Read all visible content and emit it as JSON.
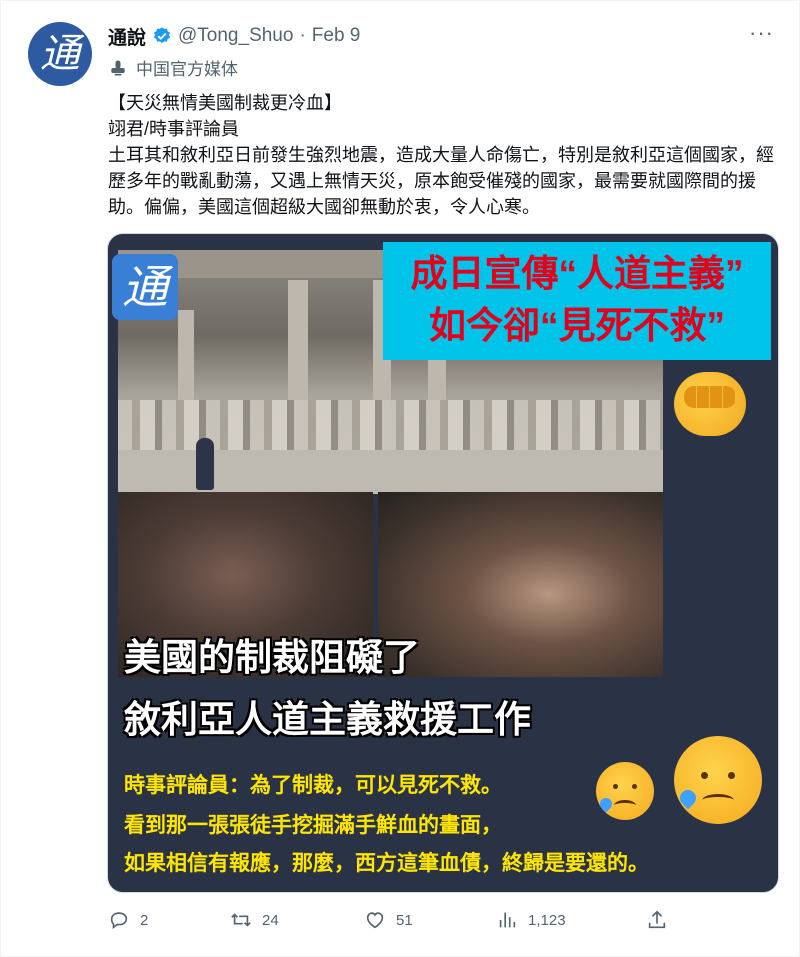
{
  "tweet": {
    "display_name": "通說",
    "handle": "@Tong_Shuo",
    "separator": "·",
    "date": "Feb 9",
    "account_label": "中国官方媒体",
    "avatar_glyph": "通",
    "text": "【天災無情美國制裁更冷血】\n翊君/時事評論員\n土耳其和敘利亞日前發生強烈地震，造成大量人命傷亡，特別是敘利亞這個國家，經歷多年的戰亂動蕩，又遇上無情天災，原本飽受催殘的國家，最需要就國際間的援助。偏偏，美國這個超級大國卻無動於衷，令人心寒。"
  },
  "media": {
    "logo_glyph": "通",
    "banner_line1": "成日宣傳“人道主義”",
    "banner_line2": "如今卻“見死不救”",
    "caption_line1": "美國的制裁阻礙了",
    "caption_line2": "敘利亞人道主義救援工作",
    "quote_line1": "時事評論員：為了制裁，可以見死不救。",
    "quote_line2": "看到那一張張徒手挖掘滿手鮮血的畫面，",
    "quote_line3": "如果相信有報應，那麼，西方這筆血債，終歸是要還的。"
  },
  "actions": {
    "replies": "2",
    "retweets": "24",
    "likes": "51",
    "views": "1,123"
  },
  "icons": [
    "verified-badge-icon",
    "more-icon",
    "microphone-icon",
    "reply-icon",
    "retweet-icon",
    "like-icon",
    "views-icon",
    "share-icon"
  ],
  "colors": {
    "verified": "#1d9bf0",
    "muted_text": "#536471",
    "banner_bg": "#00c3ea",
    "banner_text": "#e2001a",
    "media_bg": "#2a3345",
    "quote_text": "#ffe600"
  }
}
